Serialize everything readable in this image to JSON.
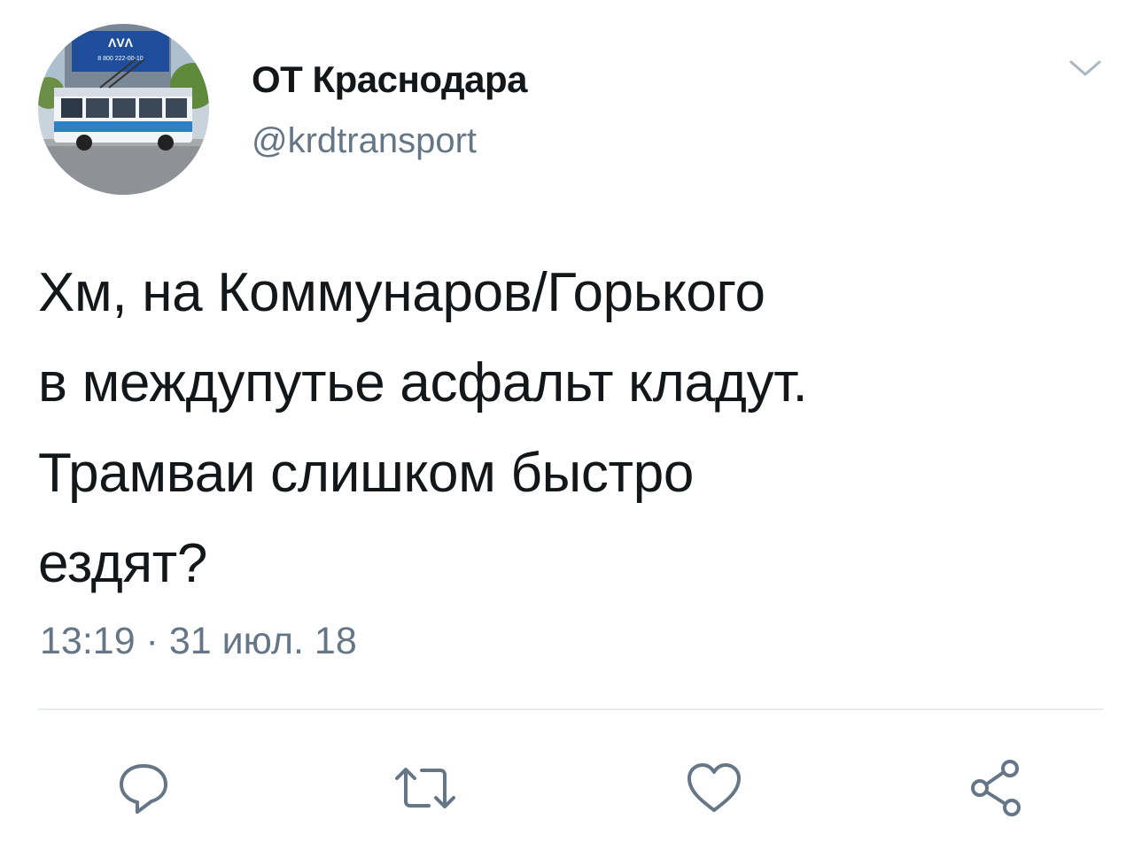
{
  "tweet": {
    "display_name": "ОТ Краснодара",
    "handle": "@krdtransport",
    "text": "Хм, на Коммунаров/Горького\nв междупутье асфальт кладут.\nТрамваи слишком быстро\nездят?",
    "timestamp": "13:19 · 31 июл. 18"
  },
  "avatar": {
    "sign_text": "8 800 222-00-10",
    "icon": "trolleybus-photo"
  },
  "actions": {
    "reply_icon": "reply-icon",
    "retweet_icon": "retweet-icon",
    "like_icon": "heart-icon",
    "share_icon": "share-icon"
  },
  "colors": {
    "text": "#14171a",
    "secondary": "#657786",
    "divider": "#e6ecf0",
    "icon": "#657786"
  }
}
